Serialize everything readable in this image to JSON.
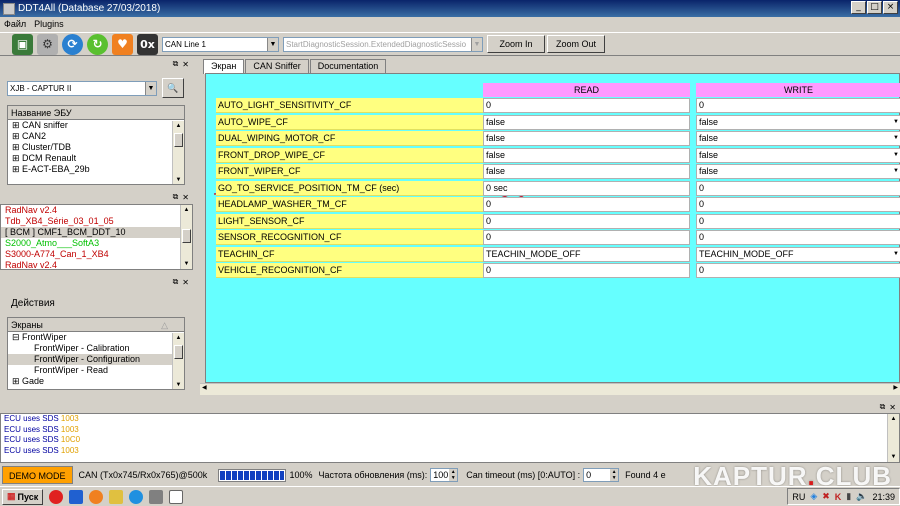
{
  "window": {
    "title": "DDT4All (Database 27/03/2018)"
  },
  "menu": {
    "items": [
      "Файл",
      "Plugins"
    ]
  },
  "toolbar": {
    "hex_label": "0x",
    "can_line": "CAN Line 1",
    "session": "StartDiagnosticSession.ExtendedDiagnosticSessio",
    "zoom_in": "Zoom In",
    "zoom_out": "Zoom Out"
  },
  "vehicle": {
    "selected": "XJB - CAPTUR II"
  },
  "ecu_list": {
    "header": "Название ЭБУ",
    "items": [
      "CAN sniffer",
      "CAN2",
      "Cluster/TDB",
      "DCM Renault",
      "E-ACT-EBA_29b"
    ]
  },
  "ecu_files": {
    "items": [
      {
        "label": "RadNav v2.4",
        "color": "#c00000"
      },
      {
        "label": "Tdb_XB4_Série_03_01_05",
        "color": "#c00000"
      },
      {
        "label": "[ BCM ] CMF1_BCM_DDT_10",
        "color": "#000000"
      },
      {
        "label": "S2000_Atmo___SoftA3",
        "color": "#00c000"
      },
      {
        "label": "S3000-A774_Can_1_XB4",
        "color": "#c00000"
      },
      {
        "label": "RadNav v2.4",
        "color": "#c00000"
      }
    ]
  },
  "actions": {
    "title": "Действия"
  },
  "screens": {
    "header": "Экраны",
    "items": [
      {
        "label": "FrontWiper",
        "level": 0
      },
      {
        "label": "FrontWiper - Calibration",
        "level": 1
      },
      {
        "label": "FrontWiper - Configuration",
        "level": 1
      },
      {
        "label": "FrontWiper - Read",
        "level": 1
      },
      {
        "label": "Gade",
        "level": 0
      }
    ]
  },
  "tabs": [
    "Экран",
    "CAN Sniffer",
    "Documentation"
  ],
  "grid": {
    "read_header": "READ",
    "write_header": "WRITE",
    "rows": [
      {
        "label": "AUTO_LIGHT_SENSITIVITY_CF",
        "read": "0",
        "write": "0",
        "dropdown": false
      },
      {
        "label": "AUTO_WIPE_CF",
        "read": "false",
        "write": "false",
        "dropdown": true
      },
      {
        "label": "DUAL_WIPING_MOTOR_CF",
        "read": "false",
        "write": "false",
        "dropdown": true
      },
      {
        "label": "FRONT_DROP_WIPE_CF",
        "read": "false",
        "write": "false",
        "dropdown": true
      },
      {
        "label": "FRONT_WIPER_CF",
        "read": "false",
        "write": "false",
        "dropdown": true
      },
      {
        "label": "GO_TO_SERVICE_POSITION_TM_CF (sec)",
        "read": "0 sec",
        "write": "0",
        "dropdown": false
      },
      {
        "label": "HEADLAMP_WASHER_TM_CF",
        "read": "0",
        "write": "0",
        "dropdown": false
      },
      {
        "label": "LIGHT_SENSOR_CF",
        "read": "0",
        "write": "0",
        "dropdown": false
      },
      {
        "label": "SENSOR_RECOGNITION_CF",
        "read": "0",
        "write": "0",
        "dropdown": false
      },
      {
        "label": "TEACHIN_CF",
        "read": "TEACHIN_MODE_OFF",
        "write": "TEACHIN_MODE_OFF",
        "dropdown": true
      },
      {
        "label": "VEHICLE_RECOGNITION_CF",
        "read": "0",
        "write": "0",
        "dropdown": false
      }
    ]
  },
  "log": {
    "lines": [
      {
        "text": "ECU uses SDS",
        "code": "1003"
      },
      {
        "text": "ECU uses SDS",
        "code": "1003"
      },
      {
        "text": "ECU uses SDS",
        "code": "10C0"
      },
      {
        "text": "ECU uses SDS",
        "code": "1003"
      }
    ]
  },
  "status": {
    "mode": "DEMO MODE",
    "can": "CAN (Tx0x745/Rx0x765)@500k",
    "progress_percent": 100,
    "progress_label": "100%",
    "refresh_label": "Частота обновления (ms):",
    "refresh_value": "100",
    "timeout_label": "Can timeout (ms) [0:AUTO] :",
    "timeout_value": "0",
    "found": "Found 4 e"
  },
  "watermark": {
    "brand": "KAPTUR",
    "dot": ".",
    "tld": "CLUB"
  },
  "taskbar": {
    "start": "Пуск",
    "lang": "RU",
    "time": "21:39"
  }
}
